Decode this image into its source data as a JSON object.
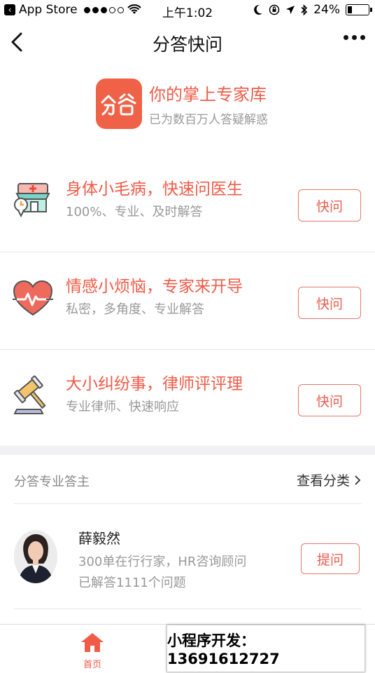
{
  "status_bar": {
    "back_app": "App Store",
    "time": "上午1:02",
    "battery": "24%",
    "battery_level": 0.24
  },
  "nav": {
    "title": "分答快问"
  },
  "brand": {
    "logo_text": "分答",
    "title": "你的掌上专家库",
    "subtitle": "已为数百万人答疑解惑"
  },
  "services": [
    {
      "icon": "clinic-icon",
      "title": "身体小毛病，快速问医生",
      "desc": "100%、专业、及时解答",
      "button": "快问"
    },
    {
      "icon": "heart-pulse-icon",
      "title": "情感小烦恼，专家来开导",
      "desc": "私密，多角度、专业解答",
      "button": "快问"
    },
    {
      "icon": "gavel-icon",
      "title": "大小纠纷事，律师评评理",
      "desc": "专业律师、快速响应",
      "button": "快问"
    }
  ],
  "experts_section": {
    "label": "分答专业答主",
    "link": "查看分类"
  },
  "expert": {
    "name": "薛毅然",
    "line1": "300单在行行家，HR咨询顾问",
    "line2": "已解答1111个问题",
    "button": "提问"
  },
  "tabbar": {
    "home_label": "首页"
  },
  "overlay": {
    "text": "小程序开发：13691612727"
  },
  "colors": {
    "accent": "#ef5b47",
    "muted": "#999999",
    "divider": "#e6e6e6"
  }
}
